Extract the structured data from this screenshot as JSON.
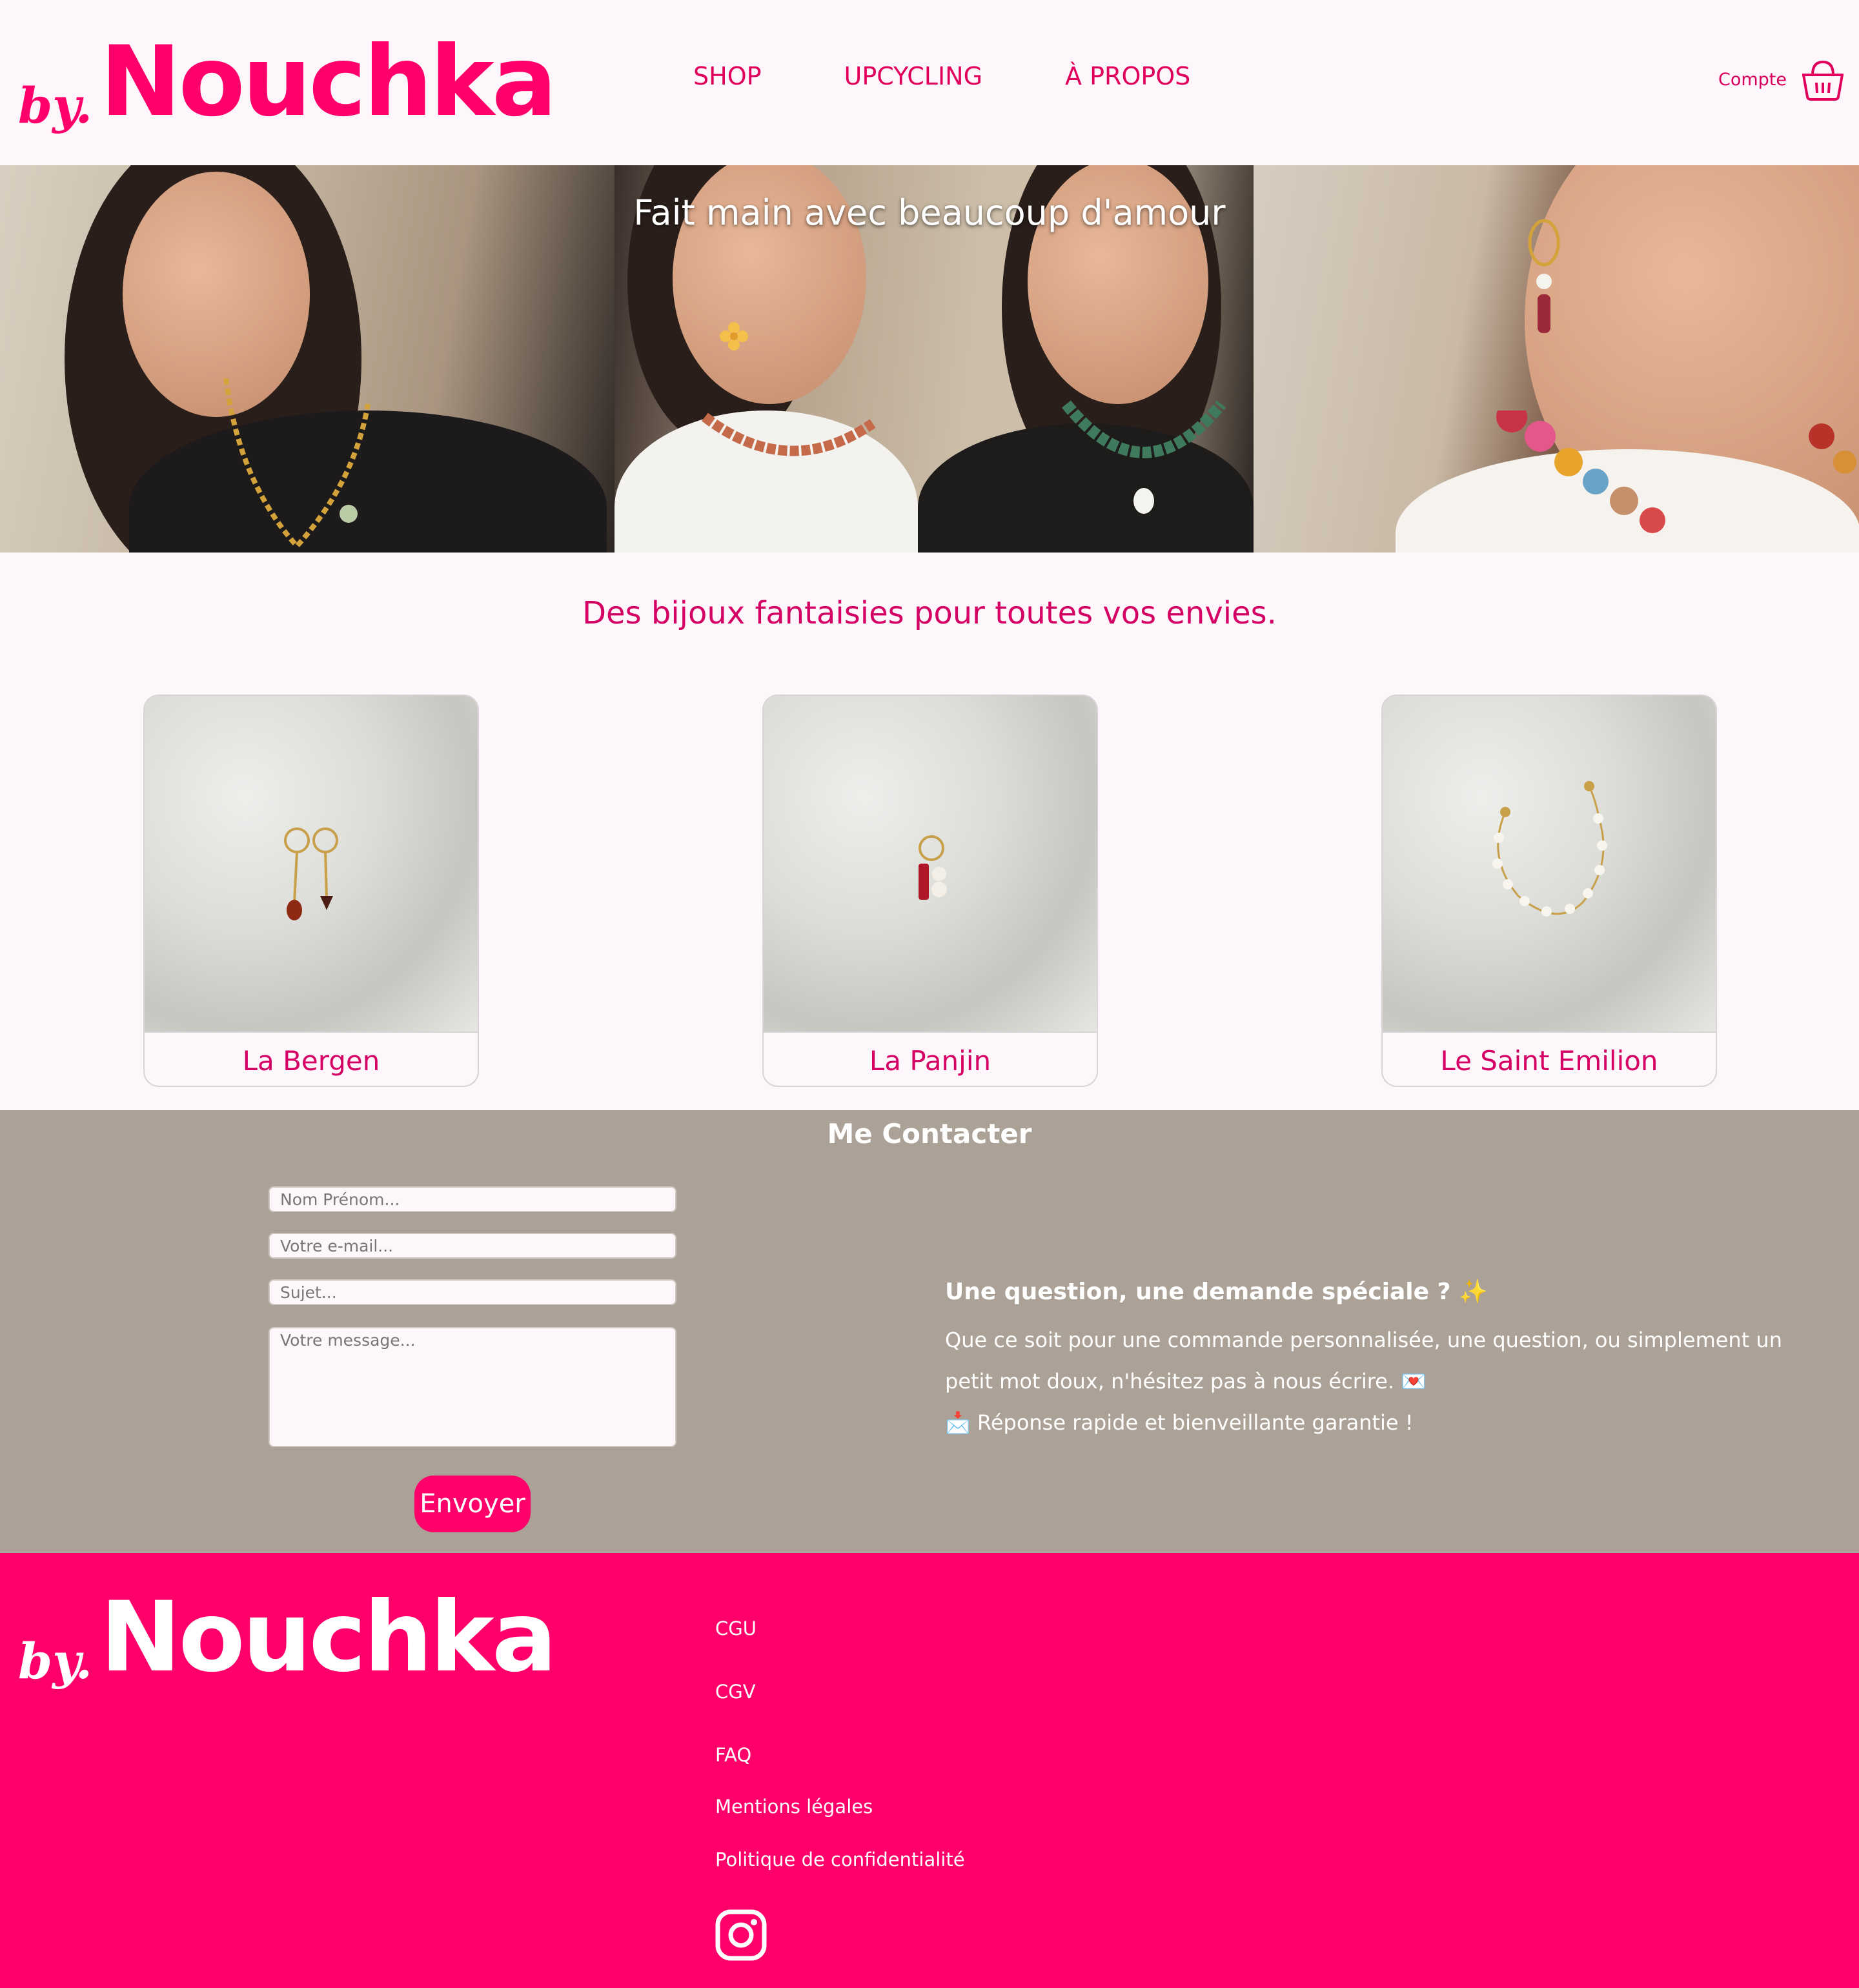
{
  "brand": {
    "by": "by.",
    "name": "Nouchka"
  },
  "nav": {
    "shop": "SHOP",
    "upcycling": "UPCYCLING",
    "about": "À PROPOS"
  },
  "header": {
    "account": "Compte"
  },
  "icons": {
    "cart": "basket-icon",
    "instagram": "instagram-icon"
  },
  "hero": {
    "caption": "Fait main avec beaucoup d'amour"
  },
  "tagline": "Des bijoux fantaisies pour toutes vos envies.",
  "products": [
    {
      "name": "La Bergen"
    },
    {
      "name": "La Panjin"
    },
    {
      "name": "Le Saint Emilion"
    }
  ],
  "contact": {
    "title": "Me Contacter",
    "name_placeholder": "Nom Prénom...",
    "email_placeholder": "Votre e-mail...",
    "subject_placeholder": "Sujet...",
    "message_placeholder": "Votre message...",
    "send": "Envoyer",
    "question": "Une question, une demande spéciale ? ✨",
    "text1": "Que ce soit pour une commande personnalisée, une question, ou simplement un petit mot doux, n'hésitez pas à nous écrire. 💌",
    "text2": "📩 Réponse rapide et bienveillante garantie !"
  },
  "footer": {
    "links": [
      "CGU",
      "CGV",
      "FAQ",
      "Mentions légales",
      "Politique de confidentialité"
    ]
  },
  "colors": {
    "brand_pink": "#ff006b",
    "background": "#fdf6fb",
    "contact_bg": "#aca196"
  }
}
